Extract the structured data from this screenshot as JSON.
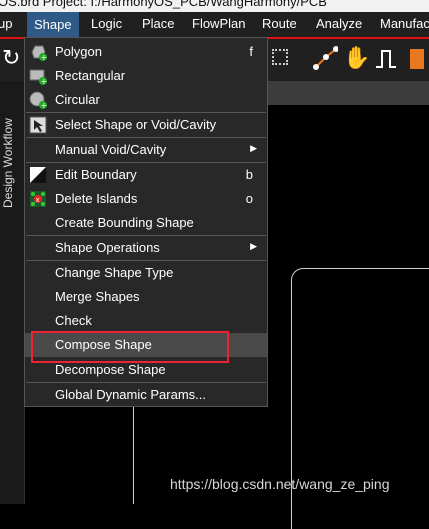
{
  "title_bar": {
    "text": "OS.brd  Project: I:/HarmonyOS_PCB/WangHarmony/PCB"
  },
  "menubar": {
    "items": [
      {
        "label": "up",
        "active": false
      },
      {
        "label": "Shape",
        "active": true
      },
      {
        "label": "Logic",
        "active": false
      },
      {
        "label": "Place",
        "active": false
      },
      {
        "label": "FlowPlan",
        "active": false
      },
      {
        "label": "Route",
        "active": false
      },
      {
        "label": "Analyze",
        "active": false
      },
      {
        "label": "Manufac",
        "active": false
      }
    ]
  },
  "left_panel": {
    "label": "Design Workflow"
  },
  "shape_menu": {
    "items": [
      {
        "label": "Polygon",
        "shortcut": "f",
        "icon": "polygon-icon"
      },
      {
        "label": "Rectangular",
        "shortcut": "",
        "icon": "rectangle-icon"
      },
      {
        "label": "Circular",
        "shortcut": "",
        "icon": "circle-icon"
      },
      {
        "label": "Select Shape or Void/Cavity",
        "shortcut": "",
        "icon": "select-shape-icon"
      },
      {
        "label": "Manual Void/Cavity",
        "shortcut": "",
        "submenu": true
      },
      {
        "label": "Edit Boundary",
        "shortcut": "b",
        "icon": "edit-boundary-icon"
      },
      {
        "label": "Delete Islands",
        "shortcut": "o",
        "icon": "delete-islands-icon"
      },
      {
        "label": "Create Bounding Shape",
        "shortcut": ""
      },
      {
        "label": "Shape Operations",
        "shortcut": "",
        "submenu": true
      },
      {
        "label": "Change Shape Type",
        "shortcut": ""
      },
      {
        "label": "Merge Shapes",
        "shortcut": ""
      },
      {
        "label": "Check",
        "shortcut": ""
      },
      {
        "label": "Compose Shape",
        "shortcut": "",
        "highlighted": true
      },
      {
        "label": "Decompose Shape",
        "shortcut": ""
      },
      {
        "label": "Global Dynamic Params...",
        "shortcut": ""
      }
    ]
  },
  "watermark": "https://blog.csdn.net/wang_ze_ping",
  "colors": {
    "menu_bg": "#282828",
    "menubar_bg": "#202020",
    "active_menu": "#2f5a87",
    "highlight": "#4a4a4a",
    "annotation_red": "#e22233"
  }
}
